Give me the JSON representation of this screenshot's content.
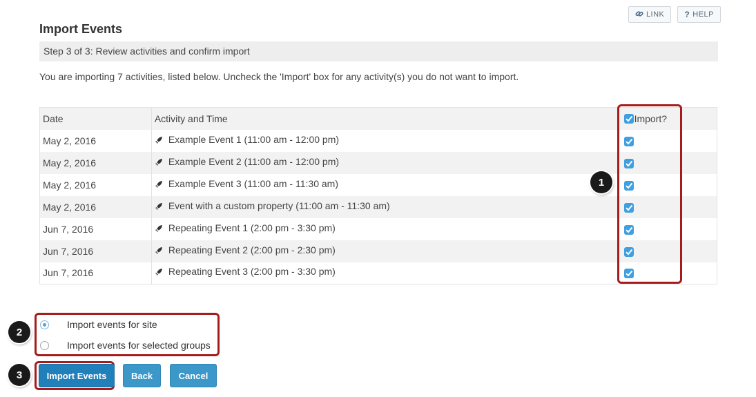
{
  "header": {
    "link_label": "LINK",
    "help_label": "HELP",
    "link_icon": "link-icon",
    "help_icon": "question-icon"
  },
  "title": "Import Events",
  "step": "Step 3 of 3: Review activities and confirm import",
  "intro": "You are importing 7 activities, listed below. Uncheck the 'Import' box for any activity(s) you do not want to import.",
  "table": {
    "columns": {
      "date": "Date",
      "activity": "Activity and Time",
      "import": "Import?"
    },
    "rows": [
      {
        "date": "May 2, 2016",
        "activity": "Example Event 1  (11:00 am - 12:00 pm)",
        "checked": true
      },
      {
        "date": "May 2, 2016",
        "activity": "Example Event 2  (11:00 am - 12:00 pm)",
        "checked": true
      },
      {
        "date": "May 2, 2016",
        "activity": "Example Event 3  (11:00 am - 11:30 am)",
        "checked": true
      },
      {
        "date": "May 2, 2016",
        "activity": "Event with a custom property  (11:00 am - 11:30 am)",
        "checked": true
      },
      {
        "date": "Jun 7, 2016",
        "activity": "Repeating Event 1  (2:00 pm - 3:30 pm)",
        "checked": true
      },
      {
        "date": "Jun 7, 2016",
        "activity": "Repeating Event 2  (2:00 pm - 2:30 pm)",
        "checked": true
      },
      {
        "date": "Jun 7, 2016",
        "activity": "Repeating Event 3  (2:00 pm - 3:30 pm)",
        "checked": true
      }
    ]
  },
  "options": {
    "site_label": "Import events for site",
    "groups_label": "Import events for selected groups",
    "selected": "site"
  },
  "buttons": {
    "import_label": "Import Events",
    "back_label": "Back",
    "cancel_label": "Cancel"
  },
  "callouts": {
    "one": "1",
    "two": "2",
    "three": "3"
  },
  "colors": {
    "highlight": "#a61c1c",
    "primary_button": "#2180ba",
    "checkbox": "#3f9fe0"
  }
}
